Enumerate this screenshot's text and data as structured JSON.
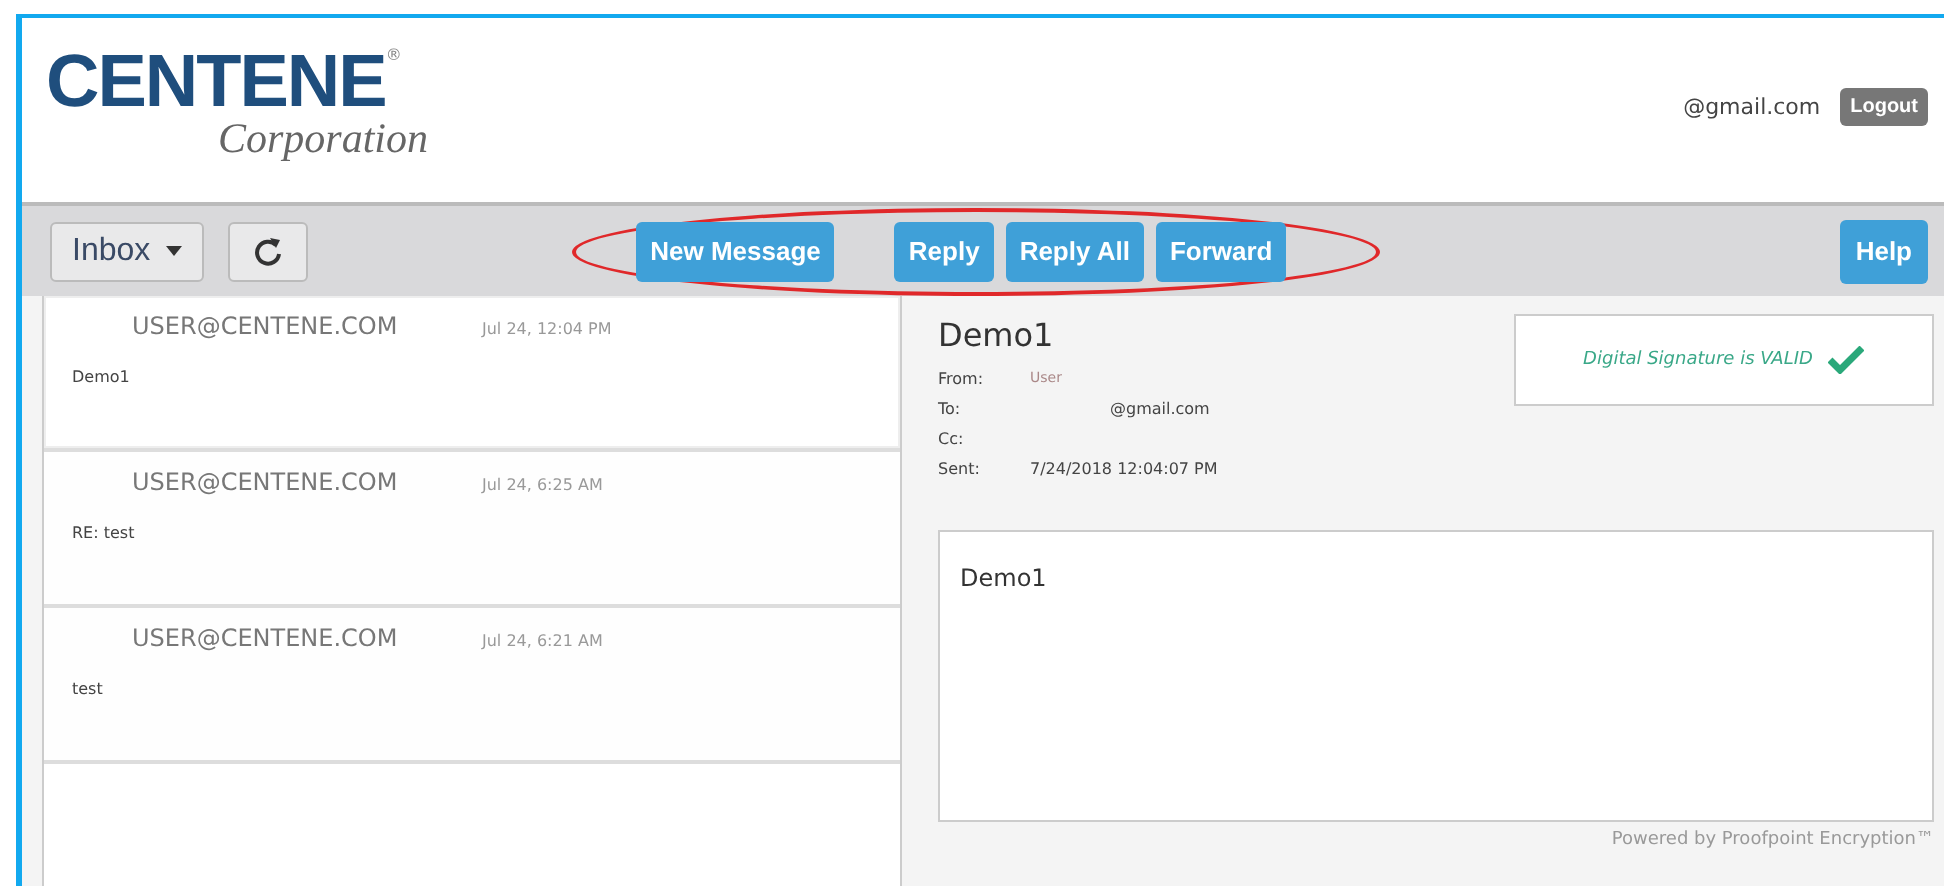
{
  "brand": {
    "name": "CENTENE",
    "registered": "®",
    "subtitle": "Corporation"
  },
  "account": {
    "email": "@gmail.com",
    "logout": "Logout"
  },
  "toolbar": {
    "folder": "Inbox",
    "actions": [
      "New Message",
      "Reply",
      "Reply All",
      "Forward"
    ],
    "help": "Help"
  },
  "messages": [
    {
      "sender": "USER@CENTENE.COM",
      "time": "Jul 24, 12:04 PM",
      "subject": "Demo1",
      "selected": true
    },
    {
      "sender": "USER@CENTENE.COM",
      "time": "Jul 24, 6:25 AM",
      "subject": "RE: test",
      "selected": false
    },
    {
      "sender": "USER@CENTENE.COM",
      "time": "Jul 24, 6:21 AM",
      "subject": "test",
      "selected": false
    }
  ],
  "reader": {
    "subject": "Demo1",
    "signature": "Digital Signature is VALID",
    "signature_valid": true,
    "headers": [
      {
        "label": "From:",
        "value": "User",
        "kind": "sender"
      },
      {
        "label": "To:",
        "value": "@gmail.com",
        "kind": "address"
      },
      {
        "label": "Cc:",
        "kind": "address"
      },
      {
        "label": "Sent:",
        "value": "7/24/2018 12:04:07 PM",
        "kind": "address"
      }
    ],
    "body": "Demo1"
  },
  "footer": "Powered by Proofpoint Encryption™"
}
